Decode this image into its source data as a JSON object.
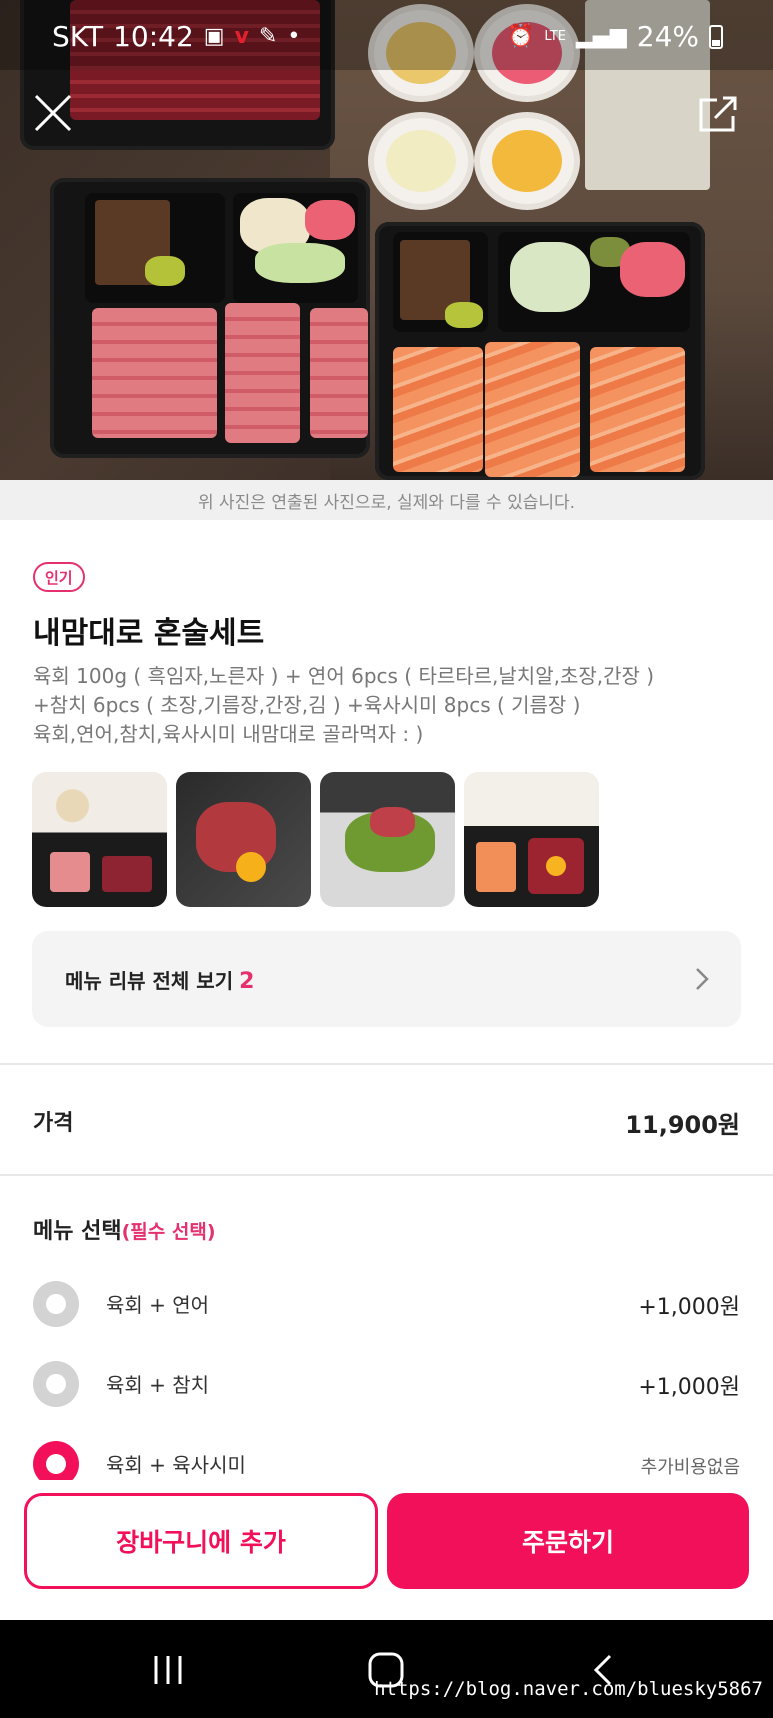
{
  "status_bar": {
    "carrier": "SKT",
    "time": "10:42",
    "network": "LTE",
    "battery": "24%"
  },
  "hero": {
    "close_icon": "close-icon",
    "share_icon": "share-icon",
    "disclaimer": "위 사진은 연출된 사진으로, 실제와 다를 수 있습니다."
  },
  "product": {
    "badge": "인기",
    "title": "내맘대로 혼술세트",
    "description": [
      "육회 100g ( 흑임자,노른자 ) + 연어 6pcs ( 타르타르,날치알,초장,간장 )",
      "+참치 6pcs ( 초장,기름장,간장,김 ) +육사시미 8pcs ( 기름장 )",
      "육회,연어,참치,육사시미 내맘대로 골라먹자 : )"
    ]
  },
  "review": {
    "label": "메뉴 리뷰 전체 보기",
    "count": "2"
  },
  "price": {
    "label": "가격",
    "value": "11,900원"
  },
  "menu_select": {
    "title": "메뉴 선택",
    "required": "(필수 선택)",
    "options": [
      {
        "label": "육회 + 연어",
        "price": "+1,000원",
        "selected": false
      },
      {
        "label": "육회 + 참치",
        "price": "+1,000원",
        "selected": false
      },
      {
        "label": "육회 + 육사시미",
        "price": "추가비용없음",
        "selected": true
      }
    ]
  },
  "actions": {
    "cart": "장바구니에 추가",
    "order": "주문하기"
  },
  "watermark": "https://blog.naver.com/bluesky5867",
  "colors": {
    "accent": "#f2105a",
    "badge": "#e5306f"
  }
}
